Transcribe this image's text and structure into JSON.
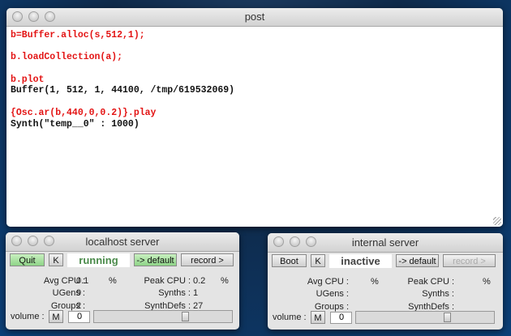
{
  "post": {
    "title": "post",
    "lines": [
      {
        "text": "b=Buffer.alloc(s,512,1);",
        "kind": "input"
      },
      {
        "text": "",
        "kind": "blank"
      },
      {
        "text": "b.loadCollection(a);",
        "kind": "input"
      },
      {
        "text": "",
        "kind": "blank"
      },
      {
        "text": "b.plot",
        "kind": "input"
      },
      {
        "text": "Buffer(1, 512, 1, 44100, /tmp/619532069)",
        "kind": "output"
      },
      {
        "text": "",
        "kind": "blank"
      },
      {
        "text": "{Osc.ar(b,440,0,0.2)}.play",
        "kind": "input"
      },
      {
        "text": "Synth(\"temp__0\" : 1000)",
        "kind": "output"
      }
    ]
  },
  "localhost": {
    "title": "localhost server",
    "boot_label": "Quit",
    "kill_label": "K",
    "status": "running",
    "status_color": "#4a8a4a",
    "default_label": "-> default",
    "record_label": "record >",
    "avg_cpu_label": "Avg CPU :",
    "avg_cpu": "0.1",
    "peak_cpu_label": "Peak CPU :",
    "peak_cpu": "0.2",
    "pct": "%",
    "ugens_label": "UGens :",
    "ugens": "9",
    "synths_label": "Synths :",
    "synths": "1",
    "groups_label": "Groups :",
    "groups": "2",
    "synthdefs_label": "SynthDefs :",
    "synthdefs": "27",
    "volume_label": "volume :",
    "mute_label": "M",
    "volume": "0",
    "volume_slider": 0.67
  },
  "internal": {
    "title": "internal server",
    "boot_label": "Boot",
    "kill_label": "K",
    "status": "inactive",
    "status_color": "#444",
    "default_label": "-> default",
    "record_label": "record >",
    "avg_cpu_label": "Avg CPU :",
    "avg_cpu": "",
    "peak_cpu_label": "Peak CPU :",
    "peak_cpu": "",
    "pct": "%",
    "ugens_label": "UGens :",
    "ugens": "",
    "synths_label": "Synths :",
    "synths": "",
    "groups_label": "Groups :",
    "groups": "",
    "synthdefs_label": "SynthDefs :",
    "synthdefs": "",
    "volume_label": "volume :",
    "mute_label": "M",
    "volume": "0",
    "volume_slider": 0.67
  }
}
